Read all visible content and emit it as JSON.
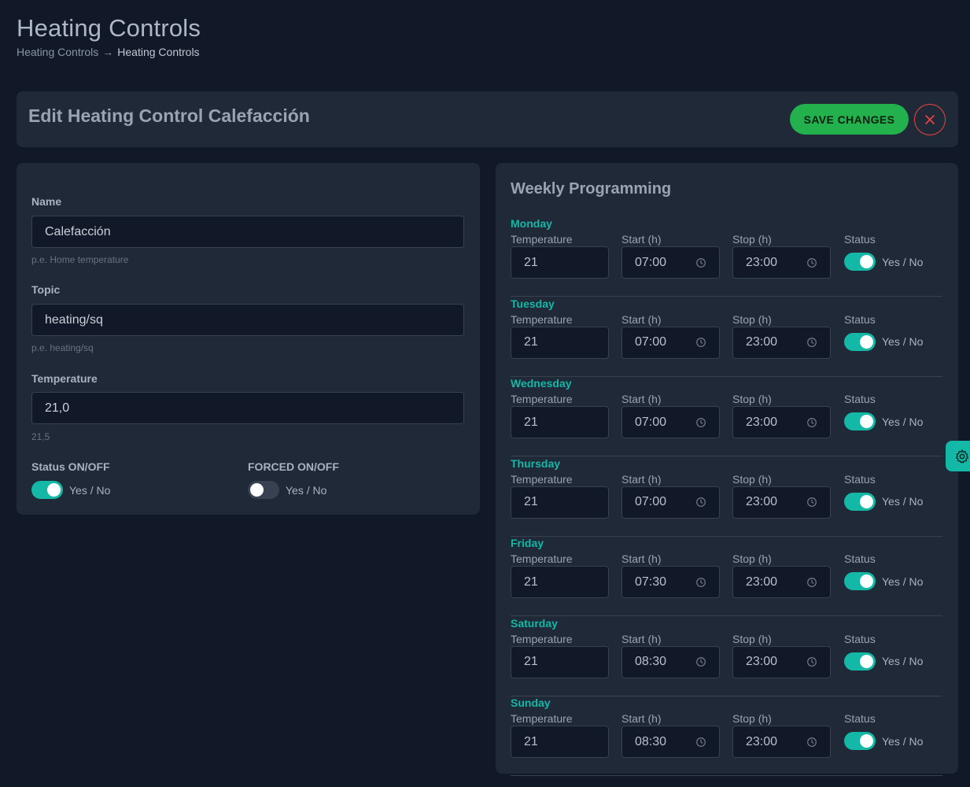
{
  "header": {
    "title": "Heating Controls",
    "breadcrumb": {
      "parent": "Heating Controls",
      "separator": "→",
      "current": "Heating Controls"
    }
  },
  "edit_bar": {
    "title": "Edit Heating Control Calefacción",
    "save_label": "SAVE CHANGES",
    "close_icon": "close-icon"
  },
  "form": {
    "name": {
      "label": "Name",
      "value": "Calefacción",
      "hint": "p.e. Home temperature"
    },
    "topic": {
      "label": "Topic",
      "value": "heating/sq",
      "hint": "p.e. heating/sq"
    },
    "temperature": {
      "label": "Temperature",
      "value": "21,0",
      "hint": "21,5"
    },
    "status": {
      "label": "Status ON/OFF",
      "toggle_text": "Yes / No",
      "on": true
    },
    "forced": {
      "label": "FORCED ON/OFF",
      "toggle_text": "Yes / No",
      "on": false
    }
  },
  "weekly": {
    "title": "Weekly Programming",
    "columns": {
      "temperature": "Temperature",
      "start": "Start (h)",
      "stop": "Stop (h)",
      "status": "Status"
    },
    "toggle_text": "Yes / No",
    "days": [
      {
        "name": "Monday",
        "temperature": "21",
        "start": "07:00",
        "stop": "23:00",
        "on": true
      },
      {
        "name": "Tuesday",
        "temperature": "21",
        "start": "07:00",
        "stop": "23:00",
        "on": true
      },
      {
        "name": "Wednesday",
        "temperature": "21",
        "start": "07:00",
        "stop": "23:00",
        "on": true
      },
      {
        "name": "Thursday",
        "temperature": "21",
        "start": "07:00",
        "stop": "23:00",
        "on": true
      },
      {
        "name": "Friday",
        "temperature": "21",
        "start": "07:30",
        "stop": "23:00",
        "on": true
      },
      {
        "name": "Saturday",
        "temperature": "21",
        "start": "08:30",
        "stop": "23:00",
        "on": true
      },
      {
        "name": "Sunday",
        "temperature": "21",
        "start": "08:30",
        "stop": "23:00",
        "on": true
      }
    ]
  },
  "colors": {
    "accent": "#14b8a6",
    "save": "#22b14c",
    "close": "#ef4444",
    "background": "#111827",
    "card": "#1f2937"
  },
  "settings_tab": {
    "icon": "gear-icon"
  }
}
